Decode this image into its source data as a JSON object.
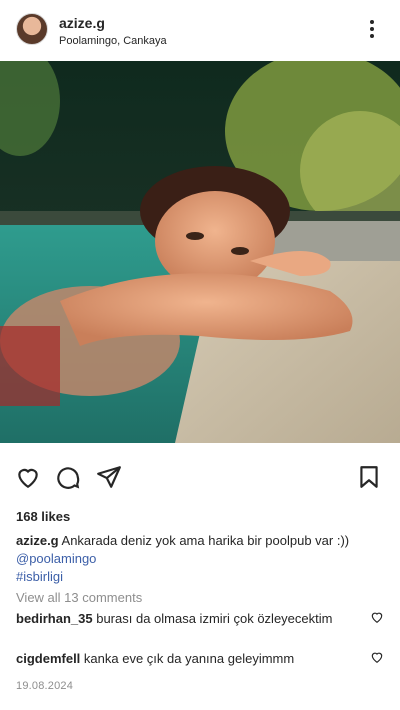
{
  "post": {
    "username": "azize.g",
    "location": "Poolamingo, Cankaya",
    "likes": "168 likes",
    "caption_user": "azize.g",
    "caption_text": "Ankarada deniz yok ama harika bir poolpub var :))",
    "mention": "@poolamingo",
    "hashtag": "#isbirligi",
    "view_all_comments": "View all 13 comments",
    "date": "19.08.2024"
  },
  "comments": [
    {
      "user": "bedirhan_35",
      "text": "burası da olmasa izmiri çok özleyecektim"
    },
    {
      "user": "cigdemfell",
      "text": "kanka eve çık da yanına geleyimmm"
    }
  ],
  "icons": {
    "more": "more-vertical-icon",
    "like": "heart-icon",
    "comment": "comment-icon",
    "share": "share-icon",
    "save": "bookmark-icon"
  }
}
